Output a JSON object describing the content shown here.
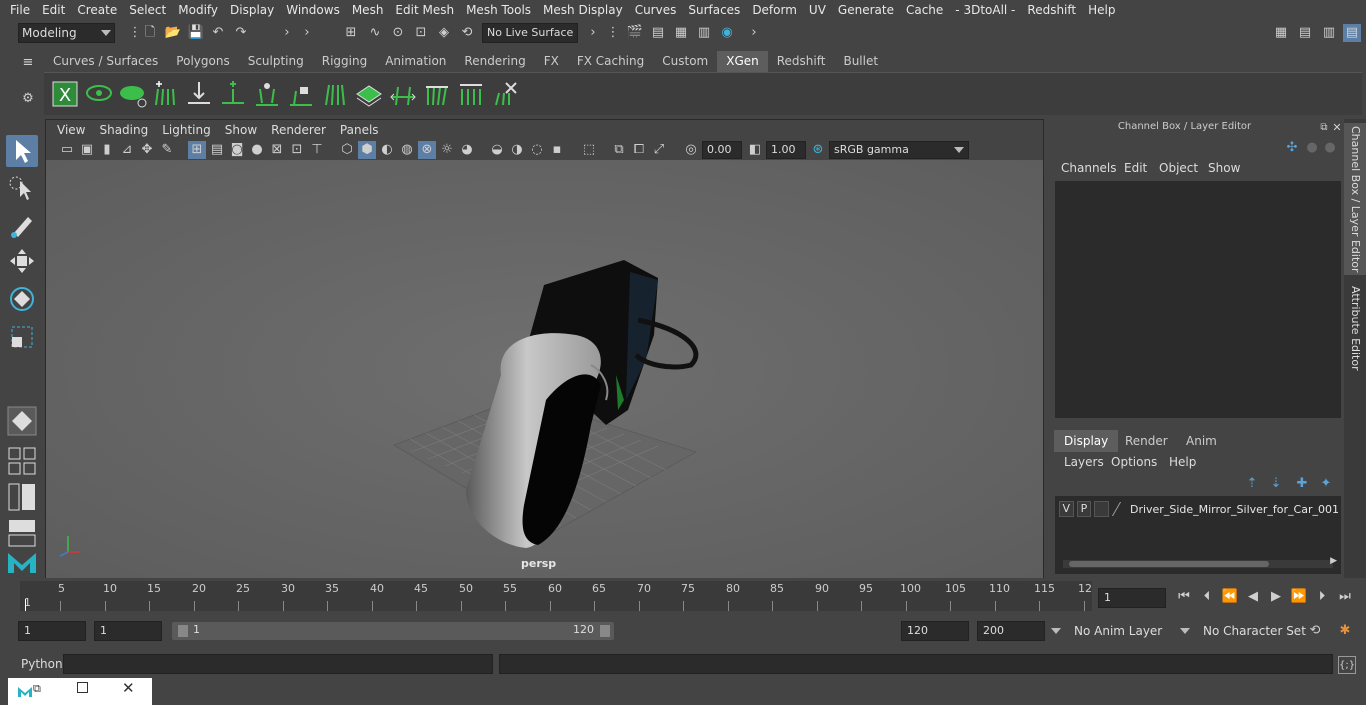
{
  "menubar": {
    "items": [
      "File",
      "Edit",
      "Create",
      "Select",
      "Modify",
      "Display",
      "Windows",
      "Mesh",
      "Edit Mesh",
      "Mesh Tools",
      "Mesh Display",
      "Curves",
      "Surfaces",
      "Deform",
      "UV",
      "Generate",
      "Cache",
      "- 3DtoAll -",
      "Redshift",
      "Help"
    ]
  },
  "status": {
    "mode": "Modeling",
    "live_surface": "No Live Surface"
  },
  "shelf": {
    "tabs": [
      "Curves / Surfaces",
      "Polygons",
      "Sculpting",
      "Rigging",
      "Animation",
      "Rendering",
      "FX",
      "FX Caching",
      "Custom",
      "XGen",
      "Redshift",
      "Bullet"
    ],
    "active_tab": "XGen"
  },
  "viewport": {
    "menu": [
      "View",
      "Shading",
      "Lighting",
      "Show",
      "Renderer",
      "Panels"
    ],
    "exposure": "0.00",
    "gamma": "1.00",
    "colorspace": "sRGB gamma",
    "camera": "persp"
  },
  "channelbox": {
    "title": "Channel Box / Layer Editor",
    "menu": [
      "Channels",
      "Edit",
      "Object",
      "Show"
    ],
    "layer_tabs": [
      "Display",
      "Render",
      "Anim"
    ],
    "active_layer_tab": "Display",
    "layer_menu": [
      "Layers",
      "Options",
      "Help"
    ],
    "layer": {
      "v": "V",
      "p": "P",
      "name": "Driver_Side_Mirror_Silver_for_Car_001"
    }
  },
  "sidetabs": [
    "Channel Box / Layer Editor",
    "Attribute Editor"
  ],
  "timeline": {
    "ticks": [
      "5",
      "10",
      "15",
      "20",
      "25",
      "30",
      "35",
      "40",
      "45",
      "50",
      "55",
      "60",
      "65",
      "70",
      "75",
      "80",
      "85",
      "90",
      "95",
      "100",
      "105",
      "110",
      "115",
      "12"
    ],
    "start_label": "1",
    "current_frame": "1"
  },
  "range": {
    "start": "1",
    "playback_start": "1",
    "slider_start": "1",
    "slider_end": "120",
    "playback_end": "120",
    "end": "200",
    "anim_layer": "No Anim Layer",
    "character_set": "No Character Set"
  },
  "cmdline": {
    "label": "Python"
  }
}
